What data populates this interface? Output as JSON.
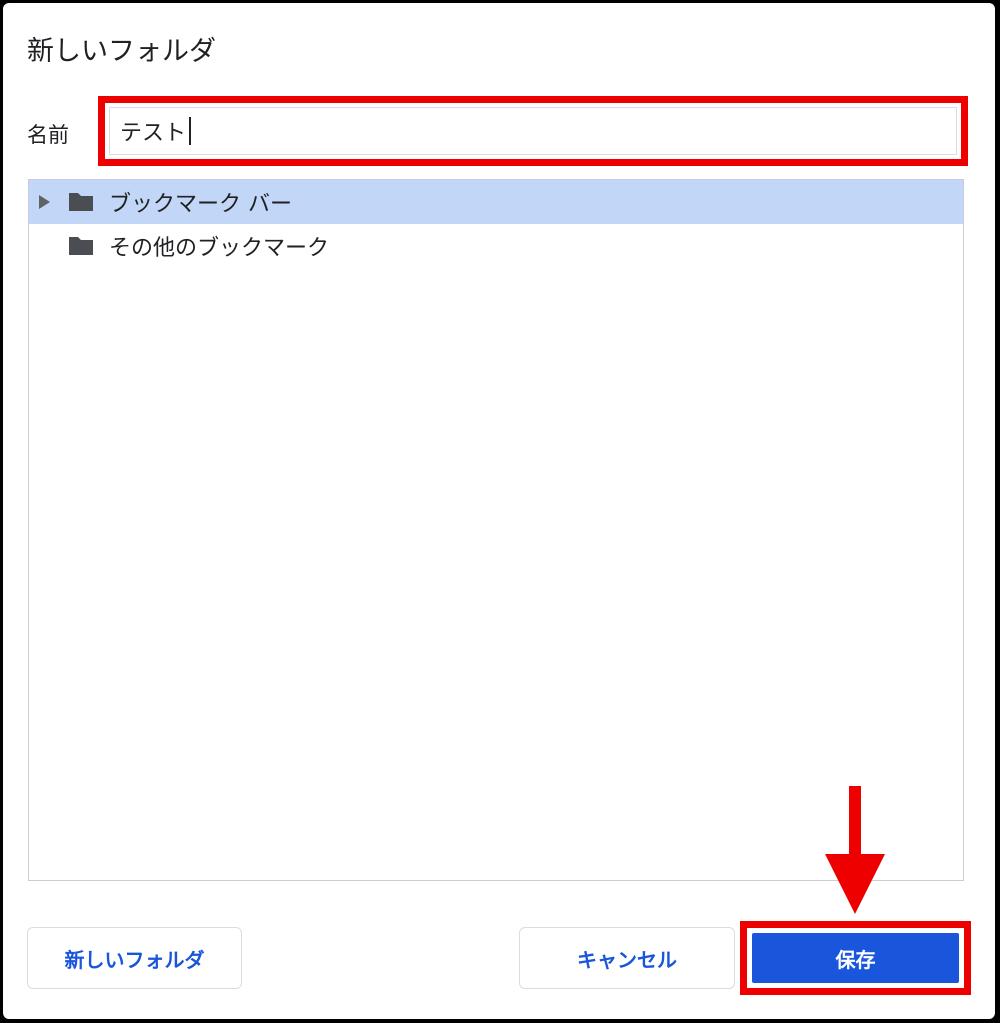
{
  "dialog": {
    "title": "新しいフォルダ",
    "name_label": "名前",
    "name_value": "テスト"
  },
  "tree": {
    "items": [
      {
        "label": "ブックマーク バー",
        "icon": "folder-icon",
        "expandable": true,
        "selected": true
      },
      {
        "label": "その他のブックマーク",
        "icon": "folder-icon",
        "expandable": false,
        "selected": false
      }
    ]
  },
  "buttons": {
    "new_folder": "新しいフォルダ",
    "cancel": "キャンセル",
    "save": "保存"
  },
  "annotations": {
    "highlight_color": "#ee0000",
    "arrow_icon": "down-arrow-icon"
  },
  "colors": {
    "accent": "#1a56db",
    "selected_row": "#c2d7f7",
    "folder": "#4a4d52"
  }
}
